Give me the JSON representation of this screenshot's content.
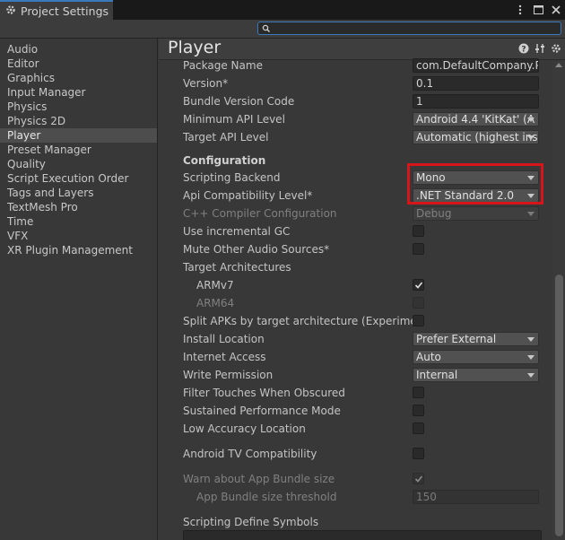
{
  "window": {
    "tab_title": "Project Settings",
    "menu_icon": "kebab-menu-icon",
    "maximize_icon": "maximize-icon",
    "close_icon": "close-icon"
  },
  "search": {
    "placeholder": "",
    "value": ""
  },
  "sidebar": {
    "items": [
      {
        "label": "Audio"
      },
      {
        "label": "Editor"
      },
      {
        "label": "Graphics"
      },
      {
        "label": "Input Manager"
      },
      {
        "label": "Physics"
      },
      {
        "label": "Physics 2D"
      },
      {
        "label": "Player",
        "selected": true
      },
      {
        "label": "Preset Manager"
      },
      {
        "label": "Quality"
      },
      {
        "label": "Script Execution Order"
      },
      {
        "label": "Tags and Layers"
      },
      {
        "label": "TextMesh Pro"
      },
      {
        "label": "Time"
      },
      {
        "label": "VFX"
      },
      {
        "label": "XR Plugin Management"
      }
    ]
  },
  "header": {
    "title": "Player"
  },
  "settings": {
    "package_name": {
      "label": "Package Name",
      "value": "com.DefaultCompany.Pa"
    },
    "version": {
      "label": "Version*",
      "value": "0.1"
    },
    "bundle_version_code": {
      "label": "Bundle Version Code",
      "value": "1"
    },
    "min_api_level": {
      "label": "Minimum API Level",
      "value": "Android 4.4 'KitKat' (A"
    },
    "target_api_level": {
      "label": "Target API Level",
      "value": "Automatic (highest ins"
    },
    "configuration": {
      "label": "Configuration"
    },
    "scripting_backend": {
      "label": "Scripting Backend",
      "value": "Mono"
    },
    "api_compat": {
      "label": "Api Compatibility Level*",
      "value": ".NET Standard 2.0"
    },
    "cpp_compiler": {
      "label": "C++ Compiler Configuration",
      "value": "Debug"
    },
    "incremental_gc": {
      "label": "Use incremental GC",
      "checked": false
    },
    "mute_audio": {
      "label": "Mute Other Audio Sources*",
      "checked": false
    },
    "target_arch": {
      "label": "Target Architectures"
    },
    "armv7": {
      "label": "ARMv7",
      "checked": true
    },
    "arm64": {
      "label": "ARM64",
      "checked": false
    },
    "split_apks": {
      "label": "Split APKs by target architecture (Experimental)",
      "checked": false
    },
    "install_location": {
      "label": "Install Location",
      "value": "Prefer External"
    },
    "internet_access": {
      "label": "Internet Access",
      "value": "Auto"
    },
    "write_permission": {
      "label": "Write Permission",
      "value": "Internal"
    },
    "filter_touches": {
      "label": "Filter Touches When Obscured",
      "checked": false
    },
    "sustained_perf": {
      "label": "Sustained Performance Mode",
      "checked": false
    },
    "low_accuracy": {
      "label": "Low Accuracy Location",
      "checked": false
    },
    "android_tv": {
      "label": "Android TV Compatibility",
      "checked": false
    },
    "warn_bundle": {
      "label": "Warn about App Bundle size",
      "checked": true
    },
    "bundle_threshold": {
      "label": "App Bundle size threshold",
      "value": "150"
    },
    "define_symbols": {
      "label": "Scripting Define Symbols"
    }
  },
  "colors": {
    "accent": "#3a79bb",
    "highlight_box": "#d6151b",
    "panel_bg": "#383838"
  }
}
